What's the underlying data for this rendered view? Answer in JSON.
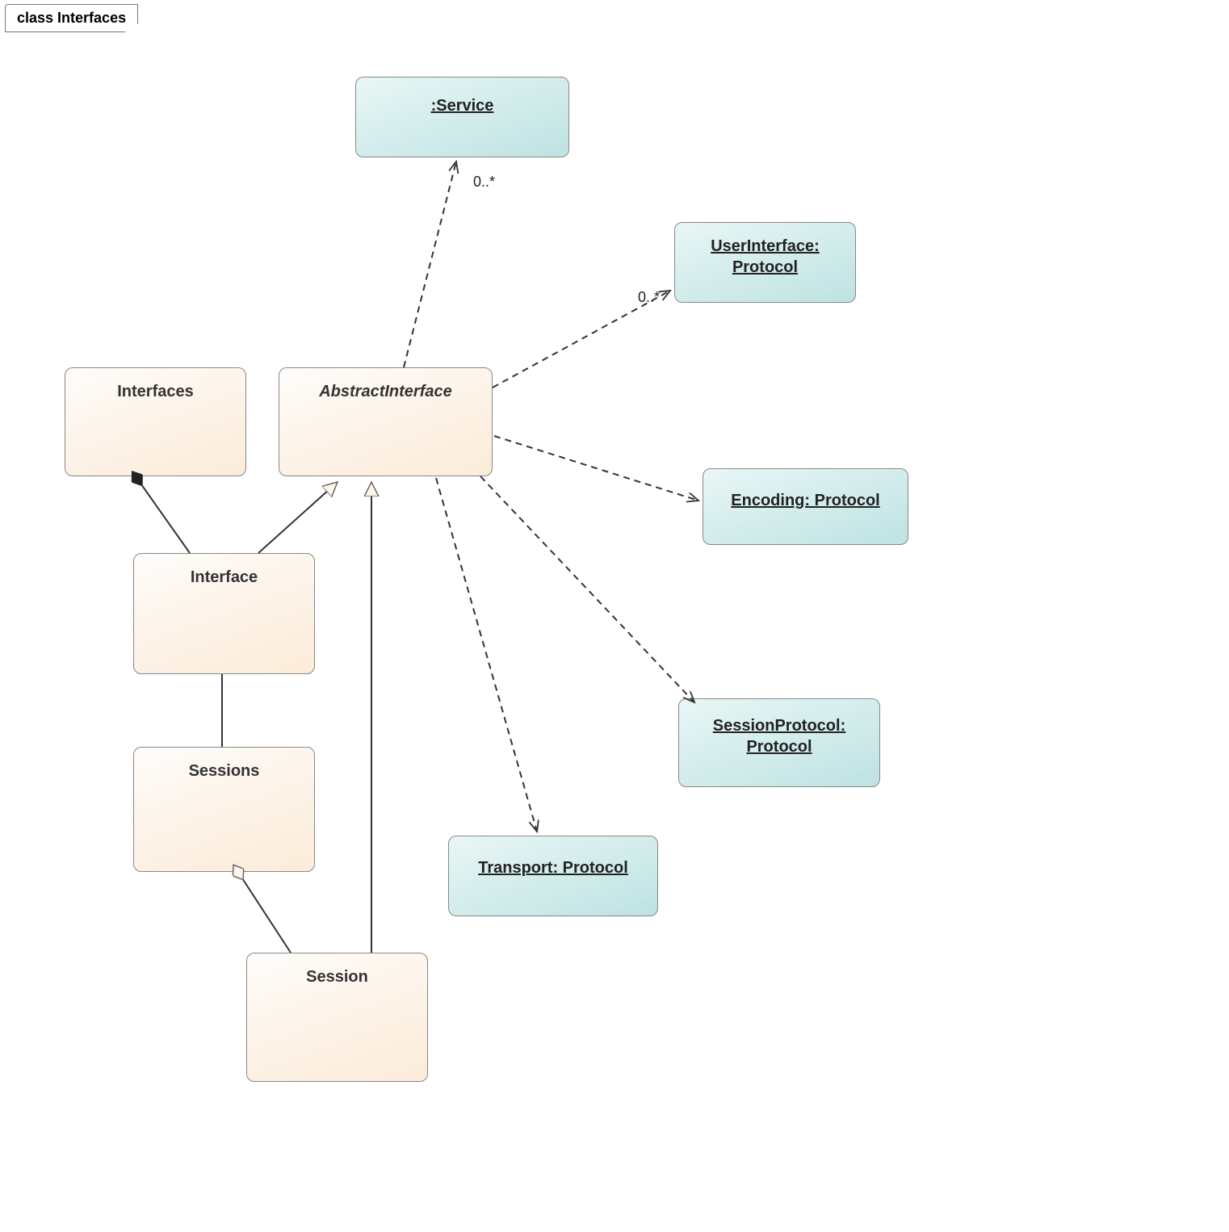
{
  "diagram": {
    "frame_label": "class Interfaces",
    "nodes": {
      "service": {
        "label": ":Service"
      },
      "userinterface": {
        "line1": "UserInterface:",
        "line2": "Protocol"
      },
      "encoding": {
        "label": "Encoding: Protocol"
      },
      "sessionprotocol": {
        "line1": "SessionProtocol:",
        "line2": "Protocol"
      },
      "transport": {
        "label": "Transport: Protocol"
      },
      "interfaces": {
        "label": "Interfaces"
      },
      "abstractinterface": {
        "label": "AbstractInterface"
      },
      "interface": {
        "label": "Interface"
      },
      "sessions": {
        "label": "Sessions"
      },
      "session": {
        "label": "Session"
      }
    },
    "multiplicities": {
      "service": "0..*",
      "userinterface": "0..*"
    }
  },
  "chart_data": {
    "type": "uml_class_diagram",
    "frame": "class Interfaces",
    "classes": [
      {
        "id": "Interfaces",
        "stereotype": "class",
        "style": "plain"
      },
      {
        "id": "AbstractInterface",
        "stereotype": "class",
        "style": "abstract"
      },
      {
        "id": "Interface",
        "stereotype": "class",
        "style": "plain"
      },
      {
        "id": "Sessions",
        "stereotype": "class",
        "style": "plain"
      },
      {
        "id": "Session",
        "stereotype": "class",
        "style": "plain"
      },
      {
        "id": ":Service",
        "stereotype": "object",
        "style": "instance"
      },
      {
        "id": "UserInterface: Protocol",
        "stereotype": "object",
        "style": "instance"
      },
      {
        "id": "Encoding: Protocol",
        "stereotype": "object",
        "style": "instance"
      },
      {
        "id": "SessionProtocol: Protocol",
        "stereotype": "object",
        "style": "instance"
      },
      {
        "id": "Transport: Protocol",
        "stereotype": "object",
        "style": "instance"
      }
    ],
    "relationships": [
      {
        "from": "AbstractInterface",
        "to": ":Service",
        "type": "dependency",
        "multiplicity_to": "0..*"
      },
      {
        "from": "AbstractInterface",
        "to": "UserInterface: Protocol",
        "type": "dependency",
        "multiplicity_to": "0..*"
      },
      {
        "from": "AbstractInterface",
        "to": "Encoding: Protocol",
        "type": "dependency"
      },
      {
        "from": "AbstractInterface",
        "to": "SessionProtocol: Protocol",
        "type": "dependency"
      },
      {
        "from": "AbstractInterface",
        "to": "Transport: Protocol",
        "type": "dependency"
      },
      {
        "from": "Interface",
        "to": "AbstractInterface",
        "type": "generalization"
      },
      {
        "from": "Session",
        "to": "AbstractInterface",
        "type": "generalization"
      },
      {
        "from": "Interfaces",
        "to": "Interface",
        "type": "composition"
      },
      {
        "from": "Interface",
        "to": "Sessions",
        "type": "association"
      },
      {
        "from": "Sessions",
        "to": "Session",
        "type": "aggregation"
      }
    ]
  }
}
